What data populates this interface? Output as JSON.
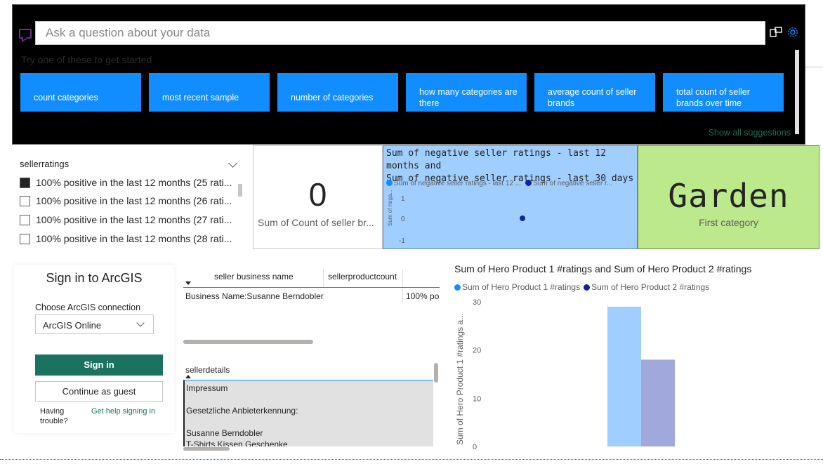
{
  "qa": {
    "placeholder": "Ask a question about your data",
    "hint": "Try one of these to get started",
    "suggestions": [
      "count categories",
      "most recent sample",
      "number of categories",
      "how many categories are there",
      "average count of seller brands",
      "total count of seller brands over time"
    ],
    "show_all": "Show all suggestions",
    "icons": [
      "chat-icon",
      "pop-out-icon",
      "settings-gear-icon"
    ],
    "accent": "#118dff"
  },
  "slicer": {
    "title": "sellerratings",
    "items": [
      {
        "label": "100% positive in the last 12 months (25 rati...",
        "checked": true
      },
      {
        "label": "100% positive in the last 12 months (26 rati...",
        "checked": false
      },
      {
        "label": "100% positive in the last 12 months (27 rati...",
        "checked": false
      },
      {
        "label": "100% positive in the last 12 months (28 rati...",
        "checked": false
      }
    ]
  },
  "card_count": {
    "value": "0",
    "label": "Sum of Count of seller br..."
  },
  "scatter": {
    "title_line1": "Sum of negative seller ratings - last 12 months and",
    "title_line2": "Sum of negative seller ratings - last 30 days",
    "legend": [
      {
        "name": "Sum of negative seller ratings - last 12 ...",
        "color": "#118dff"
      },
      {
        "name": "Sum of negative seller r...",
        "color": "#12239e"
      }
    ],
    "ylabel": "Sum of nega...",
    "ticks": [
      "1",
      "0",
      "-1"
    ],
    "background": "#9fceff"
  },
  "card_category": {
    "value": "Garden",
    "label": "First category",
    "background": "#bde98d"
  },
  "arcgis": {
    "title": "Sign in to ArcGIS",
    "connection_label": "Choose ArcGIS connection",
    "connection_value": "ArcGIS Online",
    "signin": "Sign in",
    "guest": "Continue as guest",
    "trouble": "Having trouble?",
    "help": "Get help signing in",
    "brand": "#1a7360"
  },
  "table": {
    "columns": [
      "seller business name",
      "sellerproductcount"
    ],
    "rows": [
      [
        "Business Name:Susanne Berndobler",
        "100% po"
      ]
    ]
  },
  "sellerdetails": {
    "header": "sellerdetails",
    "lines": [
      "Impressum",
      "",
      "Gesetzliche Anbieterkennung:",
      "",
      "Susanne Berndobler",
      "T-Shirts Kissen Geschenke"
    ]
  },
  "chart_data": {
    "type": "bar",
    "title": "Sum of Hero Product 1 #ratings and Sum of Hero Product 2 #ratings",
    "ylabel": "Sum of Hero Product 1 #ratings a...",
    "xlabel": "",
    "categories": [
      ""
    ],
    "series": [
      {
        "name": "Sum of Hero Product 1 #ratings",
        "values": [
          29
        ],
        "color": "#9fceff"
      },
      {
        "name": "Sum of Hero Product 2 #ratings",
        "values": [
          18
        ],
        "color": "#a0a8dc"
      }
    ],
    "ylim": [
      0,
      30
    ],
    "yticks": [
      "0",
      "10",
      "20",
      "30"
    ],
    "legend_dot_colors": [
      "#118dff",
      "#12239e"
    ]
  }
}
